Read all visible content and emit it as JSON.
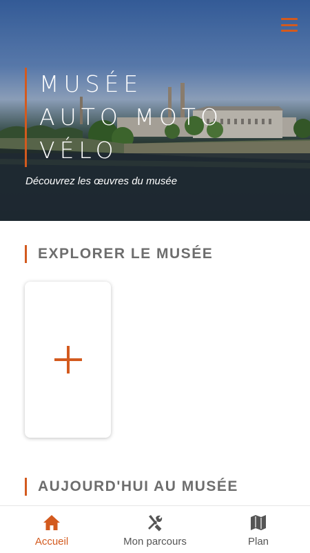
{
  "colors": {
    "accent": "#d35a1e",
    "section_title": "#6d6d6d",
    "nav_inactive": "#555555"
  },
  "header": {
    "menu_icon": "hamburger-menu-icon"
  },
  "hero": {
    "title_lines": [
      "MUSÉE",
      "AUTO MOTO",
      "VÉLO"
    ],
    "subtitle": "Découvrez les œuvres du musée"
  },
  "explore": {
    "title": "EXPLORER LE MUSÉE",
    "add_icon": "plus-icon"
  },
  "today": {
    "title": "AUJOURD'HUI AU MUSÉE"
  },
  "nav": {
    "items": [
      {
        "label": "Accueil",
        "icon": "home-icon",
        "active": true
      },
      {
        "label": "Mon parcours",
        "icon": "tools-icon",
        "active": false
      },
      {
        "label": "Plan",
        "icon": "map-icon",
        "active": false
      }
    ]
  }
}
